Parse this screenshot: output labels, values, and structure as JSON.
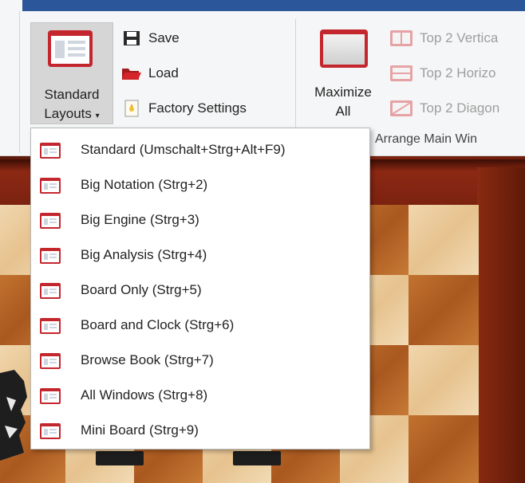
{
  "ribbon": {
    "standard_layouts": {
      "line1": "Standard",
      "line2": "Layouts",
      "caret": "▾"
    },
    "save_label": "Save",
    "load_label": "Load",
    "factory_settings_label": "Factory Settings",
    "maximize": {
      "line1": "Maximize",
      "line2": "All"
    },
    "arrange": [
      {
        "label": "Top 2 Vertica",
        "icon": "two-vertical-icon"
      },
      {
        "label": "Top 2 Horizo",
        "icon": "two-horizontal-icon"
      },
      {
        "label": "Top 2 Diagon",
        "icon": "two-diagonal-icon"
      }
    ],
    "group_label": "Arrange Main Win"
  },
  "menu": {
    "items": [
      {
        "label": "Standard (Umschalt+Strg+Alt+F9)",
        "icon": "layout-icon"
      },
      {
        "label": "Big Notation (Strg+2)",
        "icon": "layout-icon"
      },
      {
        "label": "Big Engine (Strg+3)",
        "icon": "layout-icon"
      },
      {
        "label": "Big Analysis (Strg+4)",
        "icon": "layout-icon"
      },
      {
        "label": "Board Only (Strg+5)",
        "icon": "layout-icon"
      },
      {
        "label": "Board and Clock (Strg+6)",
        "icon": "layout-icon"
      },
      {
        "label": "Browse Book (Strg+7)",
        "icon": "layout-icon"
      },
      {
        "label": "All Windows (Strg+8)",
        "icon": "layout-icon"
      },
      {
        "label": "Mini Board (Strg+9)",
        "icon": "layout-icon"
      }
    ]
  },
  "colors": {
    "accent_red": "#c4262e",
    "title_blue": "#2b579a",
    "ribbon_bg": "#f5f6f7",
    "selected_bg": "#d6d6d6",
    "disabled_text": "#9e9e9e"
  }
}
